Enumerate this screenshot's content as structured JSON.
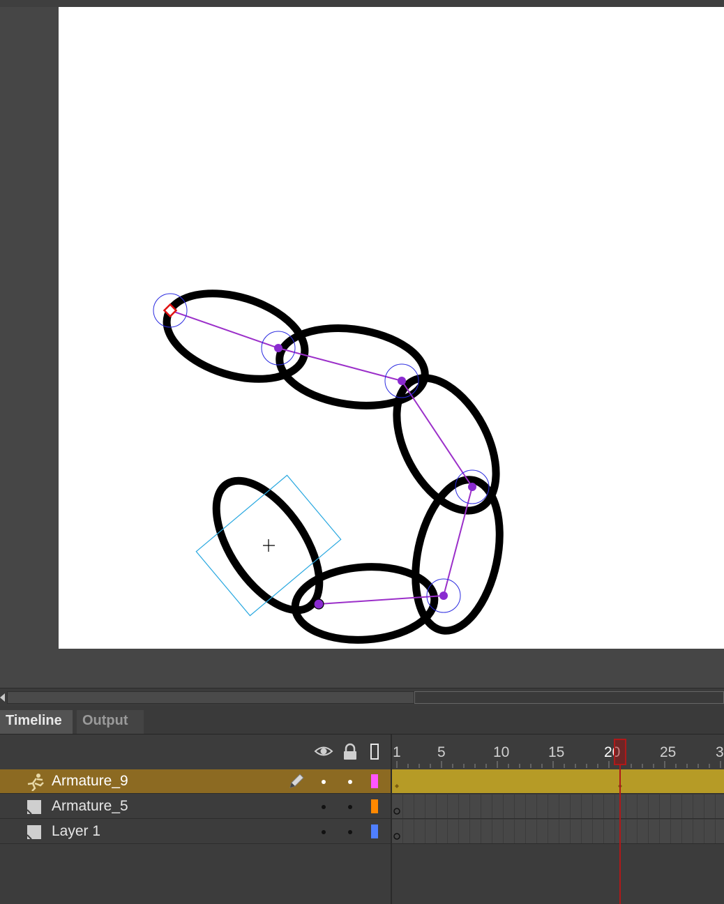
{
  "panel": {
    "tabs": [
      {
        "label": "Timeline",
        "active": true
      },
      {
        "label": "Output",
        "active": false
      }
    ]
  },
  "timeline": {
    "header_icons": [
      "eye-icon",
      "lock-icon",
      "outline-icon"
    ],
    "ruler_labels": [
      "1",
      "5",
      "10",
      "15",
      "20",
      "25",
      "3"
    ],
    "current_frame": "20",
    "layers": [
      {
        "name": "Armature_9",
        "type": "armature",
        "selected": true,
        "color": "#ff55ff"
      },
      {
        "name": "Armature_5",
        "type": "layer",
        "selected": false,
        "color": "#ff8800"
      },
      {
        "name": "Layer 1",
        "type": "layer",
        "selected": false,
        "color": "#4f7fff"
      }
    ]
  },
  "colors": {
    "bone": "#9b2fc9",
    "joint": "#8a2bd0",
    "selection": "#29a8e0",
    "playhead": "#b01919",
    "tween": "#b69b26"
  }
}
